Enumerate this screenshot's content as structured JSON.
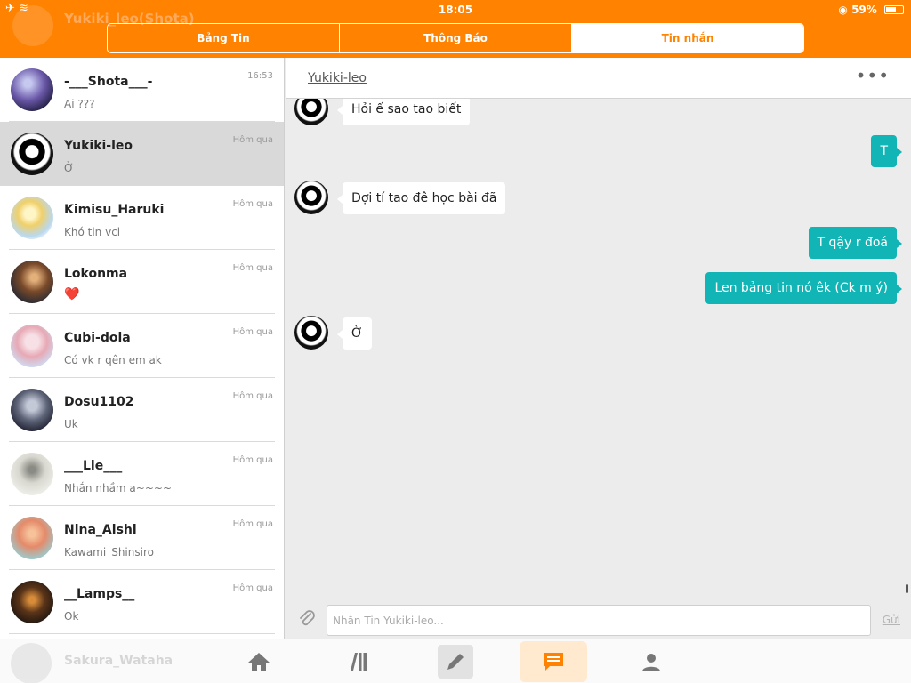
{
  "status": {
    "time": "18:05",
    "battery": "59%"
  },
  "header_ghost": {
    "name": "Yukiki_leo(Shota)"
  },
  "tabs": [
    {
      "label": "Bảng Tin",
      "active": false
    },
    {
      "label": "Thông Báo",
      "active": false
    },
    {
      "label": "Tin nhắn",
      "active": true
    }
  ],
  "conversations": [
    {
      "name": "-___Shota___-",
      "preview": "Ai ???",
      "time": "16:53"
    },
    {
      "name": "Yukiki-leo",
      "preview": "Ờ",
      "time": "Hôm qua",
      "selected": true
    },
    {
      "name": "Kimisu_Haruki",
      "preview": "Khó tin vcl",
      "time": "Hôm qua"
    },
    {
      "name": "Lokonma",
      "preview": "❤️",
      "time": "Hôm qua"
    },
    {
      "name": "Cubi-dola",
      "preview": "Có vk r qên em ak",
      "time": "Hôm qua"
    },
    {
      "name": "Dosu1102",
      "preview": "Uk",
      "time": "Hôm qua"
    },
    {
      "name": "___Lie___",
      "preview": "Nhắn nhầm a~~~~",
      "time": "Hôm qua"
    },
    {
      "name": "Nina_Aishi",
      "preview": "Kawami_Shinsiro",
      "time": "Hôm qua"
    },
    {
      "name": "__Lamps__",
      "preview": "Ok",
      "time": "Hôm qua"
    },
    {
      "name": "Sakura_Wataha",
      "preview": "",
      "time": ""
    }
  ],
  "chat": {
    "title": "Yukiki-leo",
    "more_icon": "ellipsis-icon",
    "messages": [
      {
        "dir": "in",
        "text": "Hỏi ế sao tao biết"
      },
      {
        "dir": "out",
        "text": "T"
      },
      {
        "dir": "in",
        "text": "Đợi tí tao đê học bài đã"
      },
      {
        "dir": "out",
        "text": "T qậy r đoá"
      },
      {
        "dir": "out",
        "text": "Len bảng tin nó êk (Ck m ý)"
      },
      {
        "dir": "in",
        "text": "Ờ"
      }
    ]
  },
  "composer": {
    "placeholder": "Nhắn Tin Yukiki-leo...",
    "send_label": "Gửi"
  },
  "tabbar": [
    {
      "icon": "home-icon"
    },
    {
      "icon": "library-icon"
    },
    {
      "icon": "pencil-icon"
    },
    {
      "icon": "chat-icon",
      "active": true
    },
    {
      "icon": "profile-icon"
    }
  ],
  "colors": {
    "accent": "#ff8200",
    "outgoing": "#11b5b5"
  }
}
